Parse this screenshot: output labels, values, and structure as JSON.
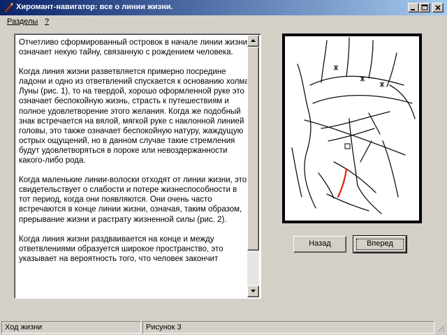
{
  "window": {
    "title": "Хиромант-навигатор: все о линии жизни.",
    "icon": "pen-icon"
  },
  "menu": {
    "items": [
      {
        "label": "Разделы"
      },
      {
        "label": "?"
      }
    ]
  },
  "content": {
    "paragraphs": [
      "Отчетливо сформированный островок в начале линии жизни означает некую тайну, связанную с рождением человека.",
      "Когда линия жизни разветвляется примерно посредине ладони и одно из ответвлений спускается к основанию холма Луны (рис. 1), то на твердой, хорошо оформленной руке это означает беспокойную жизнь, страсть к путешествиям и полное удовлетворение этого желания. Когда же подобный знак встречается на вялой, мягкой руке с наклонной линией головы, это также означает беспокойную натуру, жаждущую острых ощущений, но в данном случае такие стремления будут удовлетворяться в пороке или невоздержанности какого-либо рода.",
      "Когда маленькие линии-волоски отходят от линии жизни, это свидетельствует о слабости и потере жизнеспособности в тот период, когда они появляются. Они очень часто встречаются в конце линии жизни, означая, таким образом, прерывание жизни и растрату жизненной силы (рис. 2).",
      "Когда линия жизни раздваивается на конце и между ответвлениями образуется широкое пространство, это указывает на вероятность того, что человек закончит"
    ]
  },
  "figure": {
    "icon": "palm-drawing-icon",
    "highlight_color": "#e02010"
  },
  "buttons": {
    "back_label": "Назад",
    "next_label": "Вперед"
  },
  "status": {
    "section": "Ход жизни",
    "figure": "Рисунок 3"
  }
}
